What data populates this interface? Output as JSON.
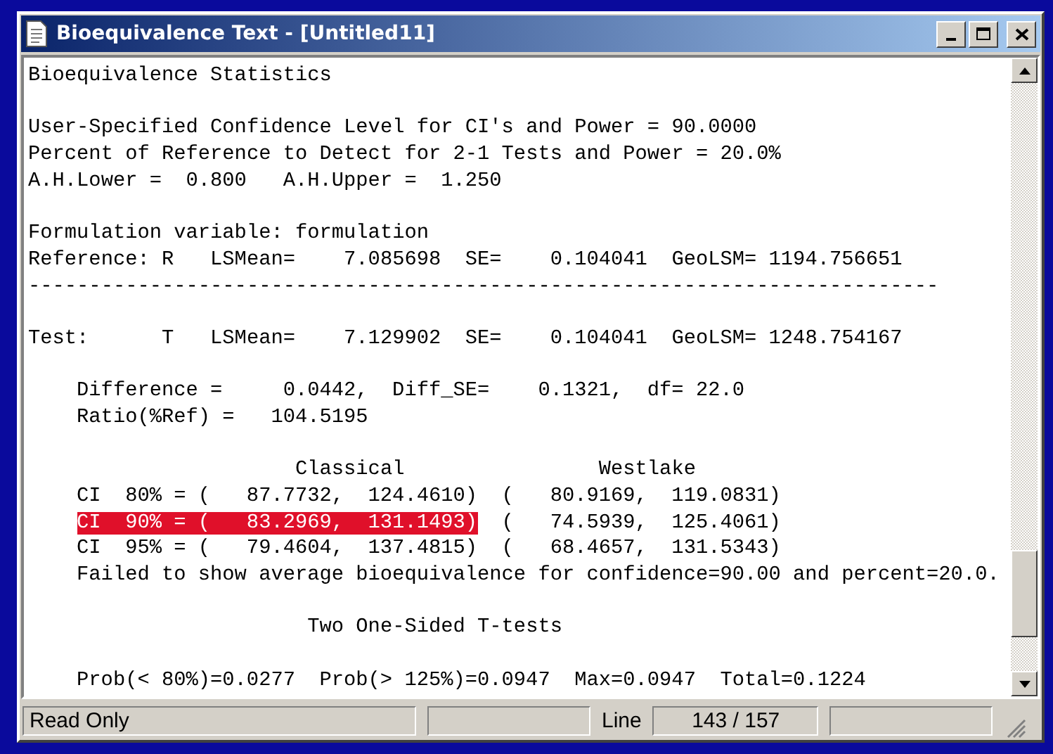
{
  "window": {
    "title": "Bioequivalence Text - [Untitled11]"
  },
  "lines": [
    {
      "kind": "text",
      "text": "Bioequivalence Statistics",
      "indented": false,
      "selected": false
    },
    {
      "kind": "blank"
    },
    {
      "kind": "text",
      "text": "User-Specified Confidence Level for CI's and Power = 90.0000",
      "indented": false,
      "selected": false
    },
    {
      "kind": "text",
      "text": "Percent of Reference to Detect for 2-1 Tests and Power = 20.0%",
      "indented": false,
      "selected": false
    },
    {
      "kind": "text",
      "text": "A.H.Lower =  0.800   A.H.Upper =  1.250",
      "indented": false,
      "selected": false
    },
    {
      "kind": "blank"
    },
    {
      "kind": "text",
      "text": "Formulation variable: formulation",
      "indented": false,
      "selected": false
    },
    {
      "kind": "text",
      "text": "Reference: R   LSMean=    7.085698  SE=    0.104041  GeoLSM= 1194.756651",
      "indented": false,
      "selected": false
    },
    {
      "kind": "text",
      "text": "---------------------------------------------------------------------------",
      "indented": false,
      "selected": false
    },
    {
      "kind": "blank"
    },
    {
      "kind": "text",
      "text": "Test:      T   LSMean=    7.129902  SE=    0.104041  GeoLSM= 1248.754167",
      "indented": false,
      "selected": false
    },
    {
      "kind": "blank"
    },
    {
      "kind": "text",
      "text": "Difference =     0.0442,  Diff_SE=    0.1321,  df= 22.0",
      "indented": true,
      "selected": false
    },
    {
      "kind": "text",
      "text": "Ratio(%Ref) =   104.5195",
      "indented": true,
      "selected": false
    },
    {
      "kind": "blank"
    },
    {
      "kind": "text",
      "text": "                      Classical                Westlake",
      "indented": false,
      "selected": false
    },
    {
      "kind": "text",
      "text": "CI  80% = (   87.7732,  124.4610)  (   80.9169,  119.0831)",
      "indented": true,
      "selected": false
    },
    {
      "kind": "text",
      "text": "CI  90% = (   83.2969,  131.1493)",
      "rest": "  (   74.5939,  125.4061)",
      "indented": true,
      "selected": true
    },
    {
      "kind": "text",
      "text": "CI  95% = (   79.4604,  137.4815)  (   68.4657,  131.5343)",
      "indented": true,
      "selected": false
    },
    {
      "kind": "text",
      "text": "Failed to show average bioequivalence for confidence=90.00 and percent=20.0.",
      "indented": true,
      "selected": false
    },
    {
      "kind": "blank"
    },
    {
      "kind": "text",
      "text": "                       Two One-Sided T-tests",
      "indented": false,
      "selected": false
    },
    {
      "kind": "blank"
    },
    {
      "kind": "text",
      "text": "Prob(< 80%)=0.0277  Prob(> 125%)=0.0947  Max=0.0947  Total=0.1224",
      "indented": true,
      "selected": false
    }
  ],
  "status_bar": {
    "mode": "Read Only",
    "line_label": "Line",
    "line_value": "143 / 157"
  }
}
